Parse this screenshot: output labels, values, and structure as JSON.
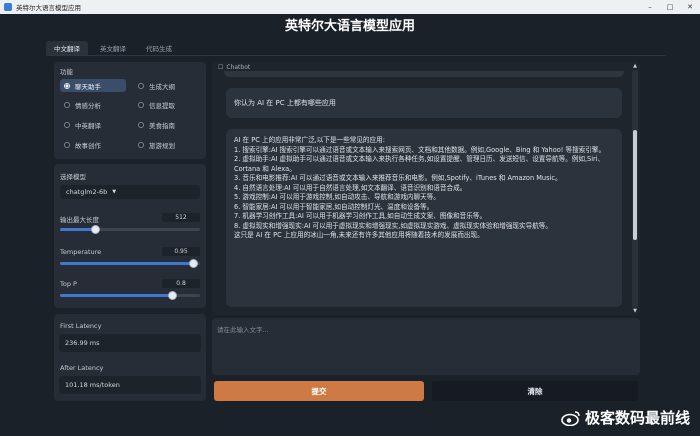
{
  "window": {
    "title": "英特尔大语言模型应用"
  },
  "app": {
    "title": "英特尔大语言模型应用"
  },
  "tabs": [
    {
      "label": "中文翻译"
    },
    {
      "label": "英文翻译"
    },
    {
      "label": "代码生成"
    }
  ],
  "function_panel": {
    "label": "功能",
    "options": [
      "聊天助手",
      "生成大纲",
      "情感分析",
      "信息提取",
      "中英翻译",
      "美食指南",
      "故事创作",
      "旅游规划"
    ],
    "selected": "聊天助手"
  },
  "settings": {
    "model_label": "选择模型",
    "model_value": "chatglm2-6b",
    "max_length_label": "输出最大长度",
    "max_length_value": "512",
    "max_length_fraction": 0.25,
    "temperature_label": "Temperature",
    "temperature_value": "0.95",
    "temperature_fraction": 0.95,
    "top_p_label": "Top P",
    "top_p_value": "0.8",
    "top_p_fraction": 0.8
  },
  "metrics": {
    "first_latency_label": "First Latency",
    "first_latency_value": "236.99 ms",
    "after_latency_label": "After Latency",
    "after_latency_value": "101.18 ms/token"
  },
  "chatbot": {
    "header": "Chatbot",
    "user_message": "你认为 AI 在 PC 上都有哪些应用",
    "bot_lines": [
      "AI 在 PC 上的应用非常广泛,以下是一些常见的应用:",
      "1. 搜索引擎:AI 搜索引擎可以通过语音或文本输入来搜索网页、文档和其他数据。例如,Google、Bing 和 Yahoo! 等搜索引擎。",
      "2. 虚拟助手:AI 虚拟助手可以通过语音或文本输入来执行各种任务,如设置提醒、管理日历、发送短信、设置导航等。例如,Siri、Cortana 和 Alexa。",
      "3. 音乐和电影推荐:AI 可以通过语音或文本输入来推荐音乐和电影。例如,Spotify、iTunes 和 Amazon Music。",
      "4. 自然语言处理:AI 可以用于自然语言处理,如文本翻译、语音识别和语音合成。",
      "5. 游戏控制:AI 可以用于游戏控制,如自动攻击、导航和游戏内聊天等。",
      "6. 智能家居:AI 可以用于智能家居,如自动控制灯光、温度和设备等。",
      "7. 机器学习创作工具:AI 可以用于机器学习创作工具,如自动生成文案、图像和音乐等。",
      "8. 虚拟现实和增强现实:AI 可以用于虚拟现实和增强现实,如虚拟现实游戏、虚拟现实体验和增强现实导航等。",
      "这只是 AI 在 PC 上应用的冰山一角,未来还有许多其他应用将随着技术的发展而出现。"
    ]
  },
  "input": {
    "placeholder": "请在此输入文字..."
  },
  "buttons": {
    "submit": "提交",
    "clear": "清除"
  },
  "watermark": {
    "text": "极客数码最前线"
  },
  "colors": {
    "accent": "#3f79d0",
    "submit": "#cf7a45",
    "background": "#1b2129"
  }
}
